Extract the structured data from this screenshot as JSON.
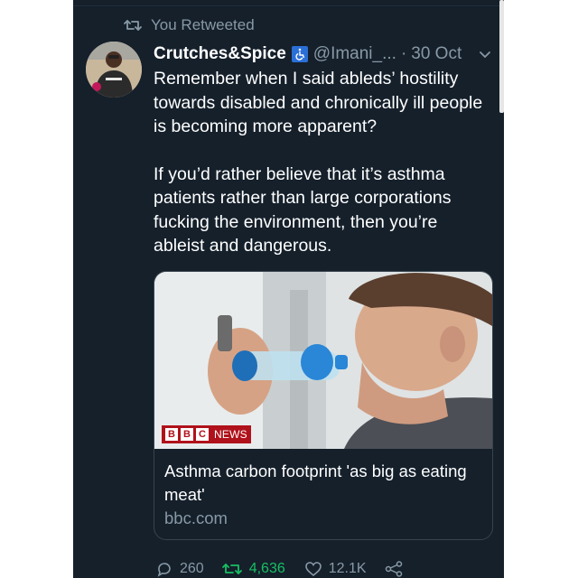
{
  "retweet": {
    "label": "You Retweeted"
  },
  "tweet": {
    "display_name": "Crutches&Spice",
    "handle": "@Imani_...",
    "separator": "·",
    "date": "30 Oct",
    "paragraphs": [
      "Remember when I said ableds’ hostility towards disabled and chronically ill people is becoming more apparent?",
      "If you’d rather believe that it’s asthma patients rather than large corporations fucking the environment, then you’re ableist and dangerous."
    ]
  },
  "card": {
    "brand_letters": [
      "B",
      "B",
      "C"
    ],
    "brand_text": "NEWS",
    "title": "Asthma carbon footprint 'as big as eating meat'",
    "domain": "bbc.com"
  },
  "actions": {
    "replies": "260",
    "retweets": "4,636",
    "likes": "12.1K"
  },
  "colors": {
    "background": "#15202b",
    "text": "#ffffff",
    "muted": "#8899a6",
    "retweet_active": "#17bf63",
    "badge": "#2a6fd6",
    "bbc_red": "#b0121b"
  },
  "icons": [
    "retweet-icon",
    "accessibility-badge-icon",
    "chevron-down-icon",
    "reply-icon",
    "like-icon",
    "share-icon"
  ]
}
